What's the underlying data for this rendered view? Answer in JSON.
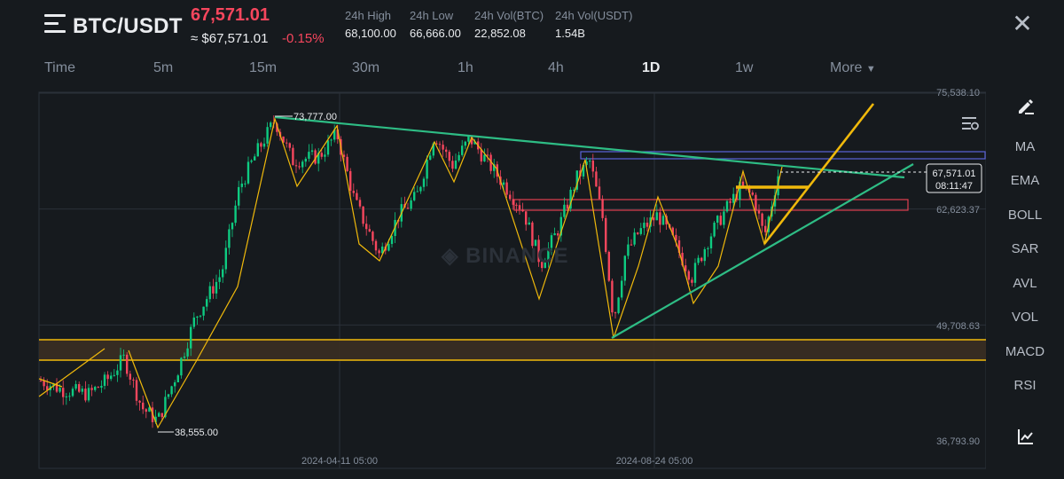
{
  "header": {
    "pair": "BTC/USDT",
    "last_price": "67,571.01",
    "approx_price": "≈ $67,571.01",
    "change_pct": "-0.15%",
    "stats": [
      {
        "label": "24h High",
        "value": "68,100.00"
      },
      {
        "label": "24h Low",
        "value": "66,666.00"
      },
      {
        "label": "24h Vol(BTC)",
        "value": "22,852.08"
      },
      {
        "label": "24h Vol(USDT)",
        "value": "1.54B"
      }
    ]
  },
  "timeframes": [
    {
      "label": "Time",
      "active": false
    },
    {
      "label": "5m",
      "active": false
    },
    {
      "label": "15m",
      "active": false
    },
    {
      "label": "30m",
      "active": false
    },
    {
      "label": "1h",
      "active": false
    },
    {
      "label": "4h",
      "active": false
    },
    {
      "label": "1D",
      "active": true
    },
    {
      "label": "1w",
      "active": false
    },
    {
      "label": "More",
      "active": false
    }
  ],
  "sidebar": {
    "indicators": [
      "MA",
      "EMA",
      "BOLL",
      "SAR",
      "AVL",
      "VOL",
      "MACD",
      "RSI"
    ]
  },
  "watermark": "BINANCE",
  "colors": {
    "up": "#0ecb81",
    "down": "#f6465d",
    "background": "#161a1e",
    "trendline_green": "#2ebd85",
    "trendline_yellow": "#f0b90b"
  },
  "chart_data": {
    "type": "candlestick",
    "price_axis_labels": [
      "75,538.10",
      "62,623.37",
      "49,708.63",
      "36,793.90"
    ],
    "time_axis_labels": [
      "2024-04-11 05:00",
      "2024-08-24 05:00"
    ],
    "current_price_label": "67,571.01",
    "countdown_label": "08:11:47",
    "annotations": [
      {
        "text": "73,777.00",
        "kind": "high"
      },
      {
        "text": "38,555.00",
        "kind": "low"
      }
    ],
    "ylim": [
      36793.9,
      75538.1
    ]
  }
}
